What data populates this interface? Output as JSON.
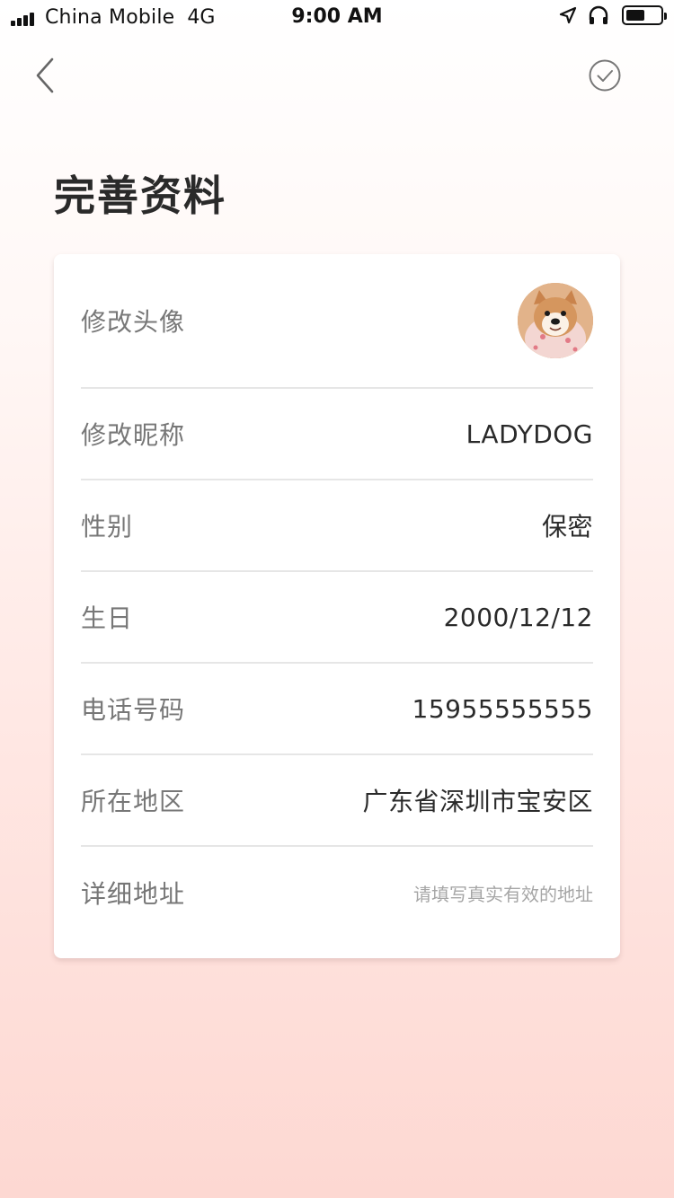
{
  "status_bar": {
    "carrier": "China Mobile",
    "network": "4G",
    "time": "9:00 AM",
    "icons": [
      "signal-icon",
      "location-arrow-icon",
      "headphones-icon",
      "battery-icon"
    ]
  },
  "nav": {
    "back_icon": "chevron-left-icon",
    "confirm_icon": "check-circle-icon"
  },
  "page": {
    "title": "完善资料"
  },
  "profile_rows": [
    {
      "label": "修改头像",
      "avatar": "dog-avatar"
    },
    {
      "label": "修改昵称",
      "value": "LADYDOG"
    },
    {
      "label": "性别",
      "value": "保密"
    },
    {
      "label": "生日",
      "value": "2000/12/12"
    },
    {
      "label": "电话号码",
      "value": "15955555555"
    },
    {
      "label": "所在地区",
      "value": "广东省深圳市宝安区"
    },
    {
      "label": "详细地址",
      "placeholder": "请填写真实有效的地址"
    }
  ],
  "colors": {
    "title": "#2a2a2a",
    "label": "#777777",
    "value": "#2a2a2a",
    "placeholder": "#a6a6a6",
    "divider": "#e6e6e6",
    "bg_top": "#ffffff",
    "bg_bottom": "#fdd8d2"
  }
}
